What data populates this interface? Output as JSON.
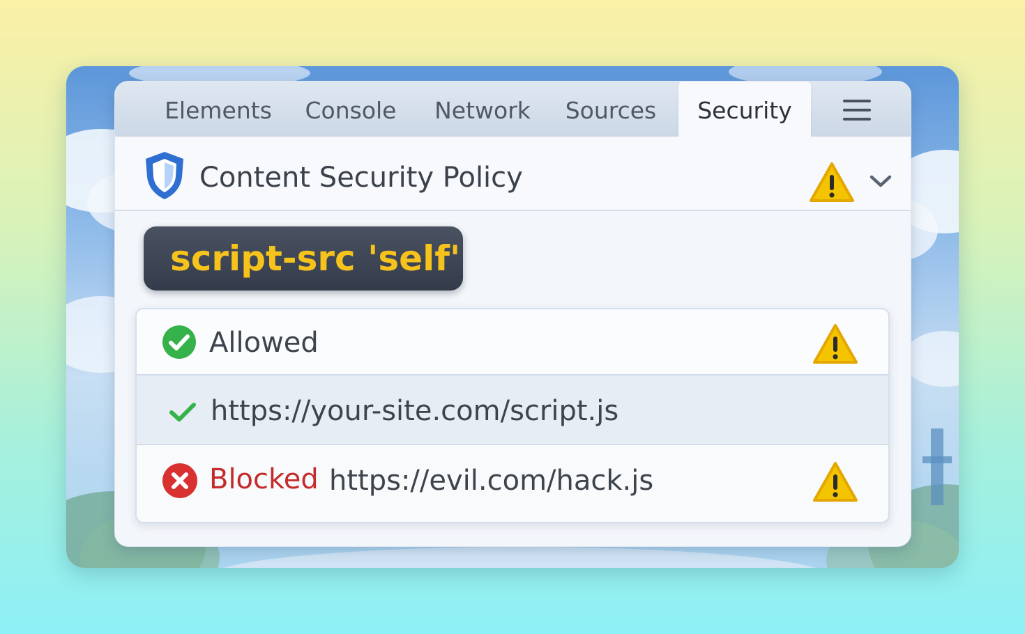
{
  "tabs": [
    {
      "label": "Elements",
      "active": false
    },
    {
      "label": "Console",
      "active": false
    },
    {
      "label": "Network",
      "active": false
    },
    {
      "label": "Sources",
      "active": false
    },
    {
      "label": "Security",
      "active": true
    }
  ],
  "menu_icon": "hamburger-menu-icon",
  "policy": {
    "title": "Content Security Policy",
    "icon": "shield-icon",
    "status_icon": "warning-icon",
    "expand_icon": "chevron-down-icon",
    "directive": "script-src 'self'"
  },
  "results": [
    {
      "icon": "check-circle-icon",
      "label": "Allowed",
      "status_icon": "warning-icon"
    },
    {
      "icon": "check-icon",
      "url": "https://your-site.com/script.js"
    },
    {
      "icon": "error-circle-icon",
      "label": "Blocked",
      "url": "https://evil.com/hack.js",
      "status_icon": "warning-icon"
    }
  ],
  "colors": {
    "accent_blue": "#2f6fd1",
    "allowed_green": "#36b24a",
    "blocked_red": "#d93030",
    "warning_yellow": "#f5c400",
    "directive_text": "#f6c21c"
  }
}
